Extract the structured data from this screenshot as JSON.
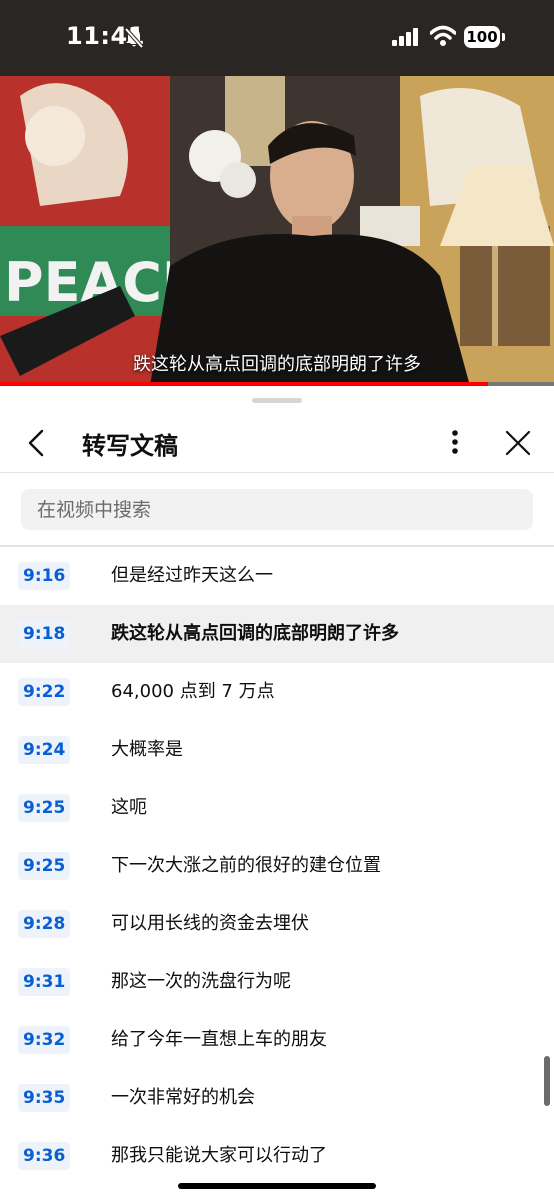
{
  "status_bar": {
    "time": "11:41",
    "battery": "100",
    "icons": [
      "bell-slash-icon",
      "cellular-signal-icon",
      "wifi-icon",
      "battery-icon"
    ]
  },
  "video": {
    "subtitle": "跌这轮从高点回调的底部明朗了许多",
    "progress": 0.88,
    "progress_color": "#ff0000"
  },
  "panel": {
    "title": "转写文稿",
    "back_icon": "chevron-left-icon",
    "more_icon": "more-vert-icon",
    "close_icon": "close-icon"
  },
  "search": {
    "placeholder": "在视频中搜索"
  },
  "transcript": [
    {
      "time": "9:16",
      "text": "但是经过昨天这么一"
    },
    {
      "time": "9:18",
      "text": "跌这轮从高点回调的底部明朗了许多",
      "active": true
    },
    {
      "time": "9:22",
      "text": "64,000 点到 7 万点"
    },
    {
      "time": "9:24",
      "text": "大概率是"
    },
    {
      "time": "9:25",
      "text": "这呃"
    },
    {
      "time": "9:25",
      "text": "下一次大涨之前的很好的建仓位置"
    },
    {
      "time": "9:28",
      "text": "可以用长线的资金去埋伏"
    },
    {
      "time": "9:31",
      "text": "那这一次的洗盘行为呢"
    },
    {
      "time": "9:32",
      "text": "给了今年一直想上车的朋友"
    },
    {
      "time": "9:35",
      "text": "一次非常好的机会"
    },
    {
      "time": "9:36",
      "text": "那我只能说大家可以行动了"
    }
  ],
  "colors": {
    "timestamp": "#065fd4",
    "timestamp_bg": "#eef3fb",
    "active_row_bg": "#f0f0f0"
  }
}
